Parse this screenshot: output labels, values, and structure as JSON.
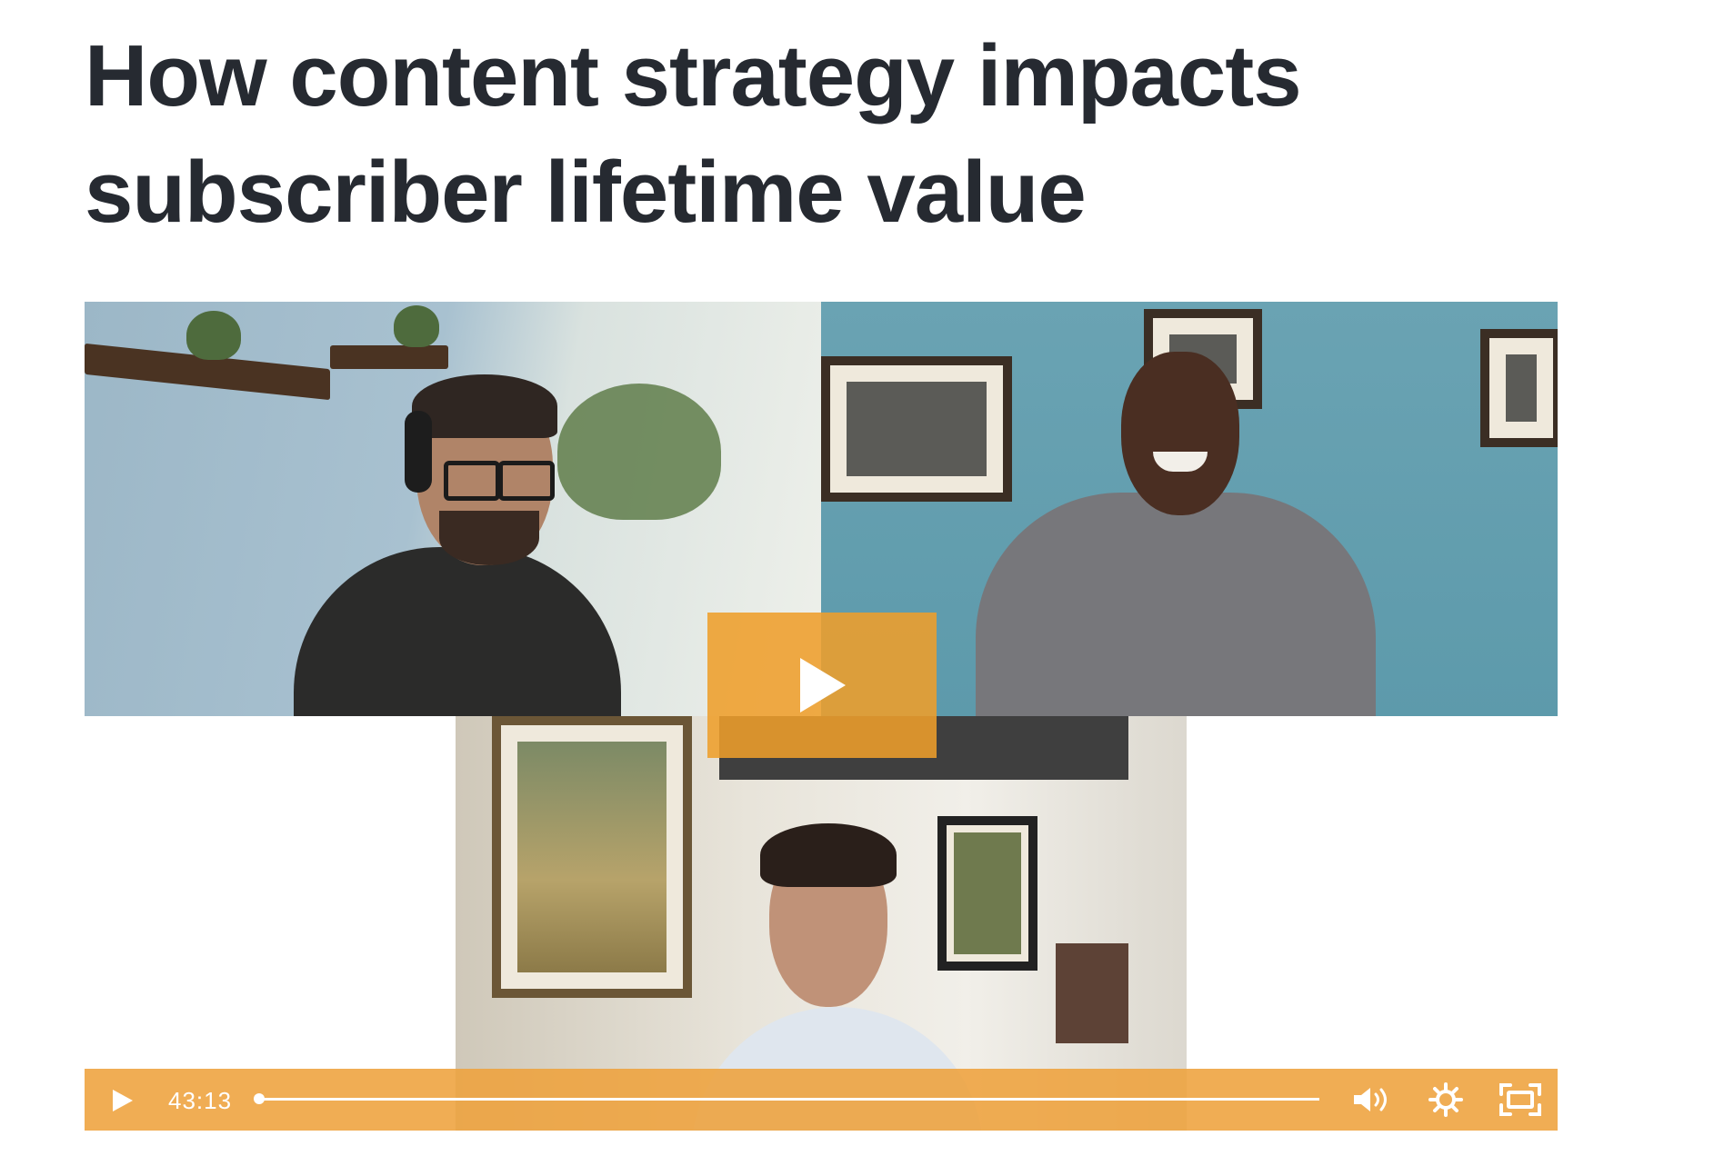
{
  "article": {
    "title_line1": "How content strategy impacts",
    "title_line2": "subscriber lifetime value"
  },
  "video": {
    "duration": "43:13",
    "progress": 0.0,
    "accent_color": "#EE9E2B",
    "icons": {
      "big_play": "play-icon",
      "play": "play-icon",
      "volume": "volume-icon",
      "settings": "gear-icon",
      "fullscreen": "fullscreen-icon"
    }
  }
}
